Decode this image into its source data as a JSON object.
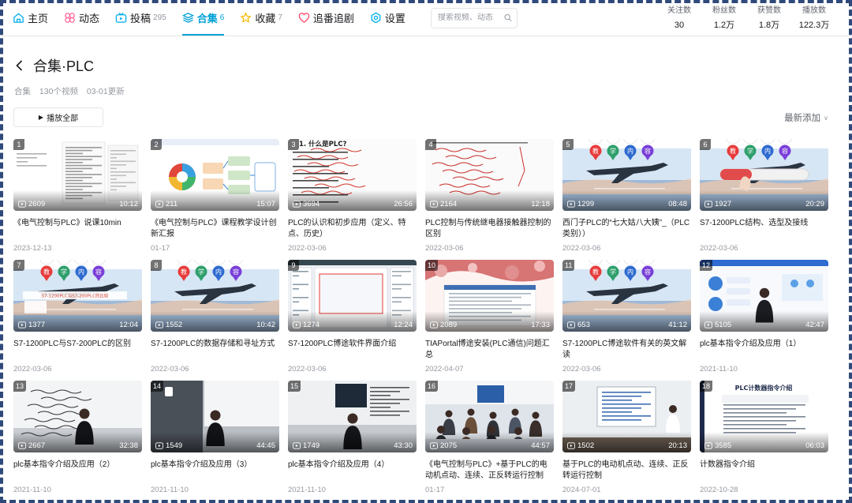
{
  "nav": {
    "items": [
      {
        "label": "主页",
        "icon": "home-icon",
        "count": "",
        "color": "#00aeec"
      },
      {
        "label": "动态",
        "icon": "dynamic-icon",
        "count": "",
        "color": "#ff6699"
      },
      {
        "label": "投稿",
        "icon": "upload-tv-icon",
        "count": "295",
        "color": "#00aeec"
      },
      {
        "label": "合集",
        "icon": "collection-layers-icon",
        "count": "6",
        "color": "#00a1d6",
        "active": true
      },
      {
        "label": "收藏",
        "icon": "star-icon",
        "count": "7",
        "color": "#f5b800"
      },
      {
        "label": "追番追剧",
        "icon": "heart-icon",
        "count": "",
        "color": "#ff4466"
      },
      {
        "label": "设置",
        "icon": "gear-icon",
        "count": "",
        "color": "#00aeec"
      }
    ],
    "search_placeholder": "搜索视频、动态"
  },
  "stats": [
    {
      "label": "关注数",
      "value": "30"
    },
    {
      "label": "粉丝数",
      "value": "1.2万"
    },
    {
      "label": "获赞数",
      "value": "1.8万"
    },
    {
      "label": "播放数",
      "value": "122.3万"
    }
  ],
  "header": {
    "title": "合集·PLC",
    "meta_type": "合集",
    "meta_count": "130个视频",
    "meta_updated": "03-01更新",
    "play_all": "播放全部",
    "sort": "最新添加"
  },
  "accent": "#00a1d6",
  "videos": [
    {
      "num": "1",
      "views": "2609",
      "duration": "10:12",
      "title": "《电气控制与PLC》说课10min",
      "date": "2023-12-13",
      "art": "doc"
    },
    {
      "num": "2",
      "views": "211",
      "duration": "15:07",
      "title": "《电气控制与PLC》课程教学设计创新汇报",
      "date": "01-17",
      "art": "diagram"
    },
    {
      "num": "3",
      "views": "3694",
      "duration": "26:56",
      "title": "PLC的认识和初步应用（定义、特点、历史）",
      "date": "2022-03-06",
      "art": "handwrite"
    },
    {
      "num": "4",
      "views": "2164",
      "duration": "12:18",
      "title": "PLC控制与传统继电器接触器控制的区别",
      "date": "2022-03-06",
      "art": "handwrite2"
    },
    {
      "num": "5",
      "views": "1299",
      "duration": "08:48",
      "title": "西门子PLC的“七大姑八大姨”_（PLC类别））",
      "date": "2022-03-06",
      "art": "plane"
    },
    {
      "num": "6",
      "views": "1927",
      "duration": "20:29",
      "title": "S7-1200PLC结构、选型及接线",
      "date": "2022-03-06",
      "art": "plane-red"
    },
    {
      "num": "7",
      "views": "1377",
      "duration": "12:04",
      "title": "S7-1200PLC与S7-200PLC的区别",
      "date": "2022-03-06",
      "art": "plane-text"
    },
    {
      "num": "8",
      "views": "1552",
      "duration": "10:42",
      "title": "S7-1200PLC的数据存储和寻址方式",
      "date": "2022-03-06",
      "art": "plane"
    },
    {
      "num": "9",
      "views": "1274",
      "duration": "12:24",
      "title": "S7-1200PLC博途软件界面介绍",
      "date": "2022-03-06",
      "art": "software"
    },
    {
      "num": "10",
      "views": "2089",
      "duration": "17:33",
      "title": "TIAPortal博途安装(PLC通信)问题汇总",
      "date": "2022-04-07",
      "art": "flowers"
    },
    {
      "num": "11",
      "views": "653",
      "duration": "41:12",
      "title": "S7-1200PLC博途软件有关的英文解读",
      "date": "2022-03-06",
      "art": "plane"
    },
    {
      "num": "12",
      "views": "5105",
      "duration": "42:47",
      "title": "plc基本指令介绍及应用（1）",
      "date": "2021-11-10",
      "art": "lecture-slide"
    },
    {
      "num": "13",
      "views": "2667",
      "duration": "32:38",
      "title": "plc基本指令介绍及应用（2）",
      "date": "2021-11-10",
      "art": "whiteboard"
    },
    {
      "num": "14",
      "views": "1549",
      "duration": "44:45",
      "title": "plc基本指令介绍及应用（3）",
      "date": "2021-11-10",
      "art": "whiteboard2"
    },
    {
      "num": "15",
      "views": "1749",
      "duration": "43:30",
      "title": "plc基本指令介绍及应用（4）",
      "date": "2021-11-10",
      "art": "whiteboard3"
    },
    {
      "num": "16",
      "views": "2075",
      "duration": "44:57",
      "title": "《电气控制与PLC》+基于PLC的电动机点动、连续、正反转运行控制",
      "date": "01-17",
      "art": "classroom"
    },
    {
      "num": "17",
      "views": "1502",
      "duration": "20:13",
      "title": "基于PLC的电动机点动、连续、正反转运行控制",
      "date": "2024-07-01",
      "art": "screen"
    },
    {
      "num": "18",
      "views": "3585",
      "duration": "06:03",
      "title": "计数器指令介绍",
      "date": "2022-10-28",
      "art": "counter"
    }
  ],
  "overlay_texts": {
    "v3": "1. 什么是PLC?",
    "v5": [
      "教",
      "学",
      "内",
      "容"
    ],
    "v7_line": "S7-1200PLC与S7-200PLC的比较",
    "v18_title": "PLC计数器指令介绍"
  }
}
